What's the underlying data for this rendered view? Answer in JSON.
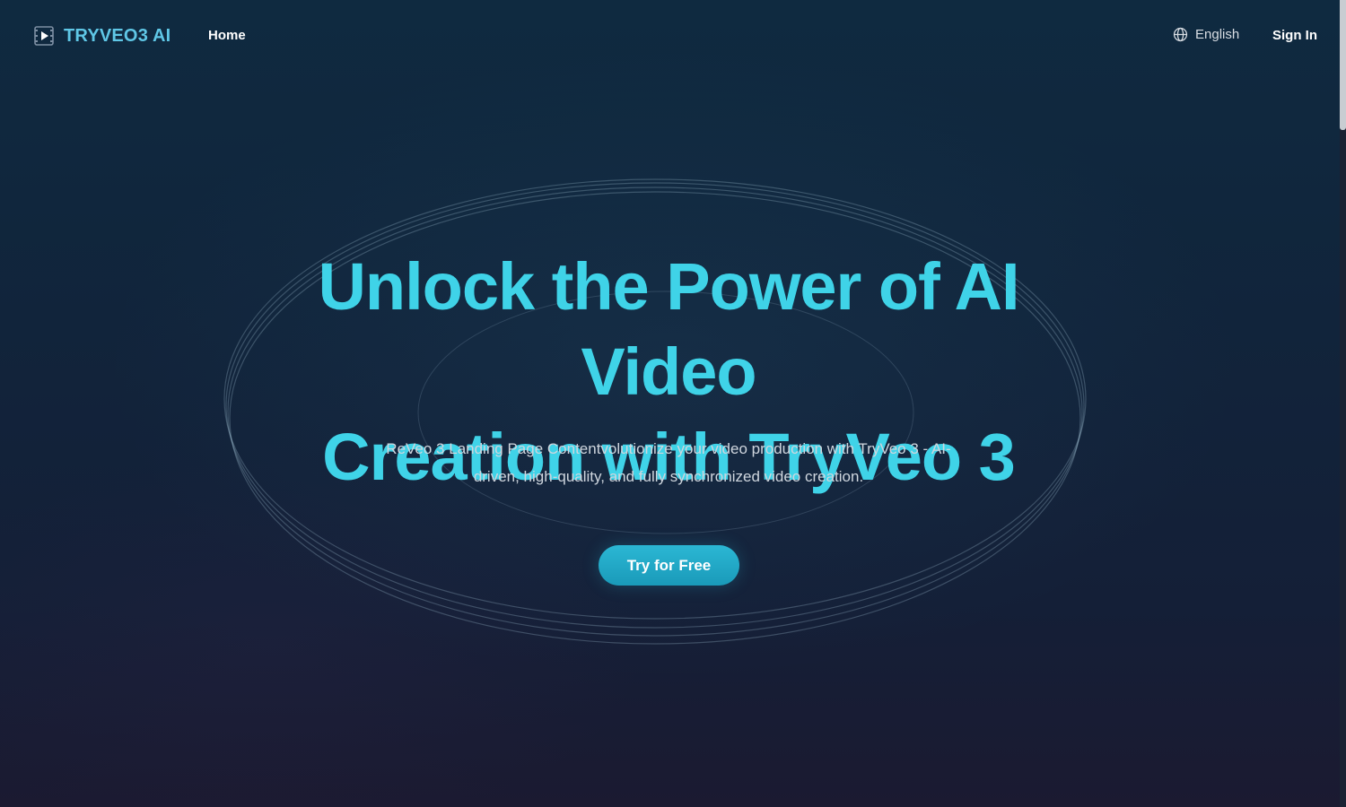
{
  "header": {
    "logo_text": "TRYVEO3 AI",
    "logo_icon": "video-play-icon",
    "nav": {
      "home_label": "Home"
    },
    "language": {
      "icon": "globe-icon",
      "label": "English"
    },
    "signin_label": "Sign In"
  },
  "hero": {
    "title_line1": "Unlock the Power of AI Video",
    "title_line2": "Creation with TryVeo 3",
    "subtitle_line1": "ReVeo 3 Landing Page Contentvolutionize your video production with TryVeo 3 - AI-",
    "subtitle_line2": "driven, high-quality, and fully synchronized video creation.",
    "cta_label": "Try for Free"
  },
  "colors": {
    "accent": "#3fd3e8",
    "logo": "#5fc7e6",
    "button": "#1fa8c6",
    "background": "#11243b"
  }
}
